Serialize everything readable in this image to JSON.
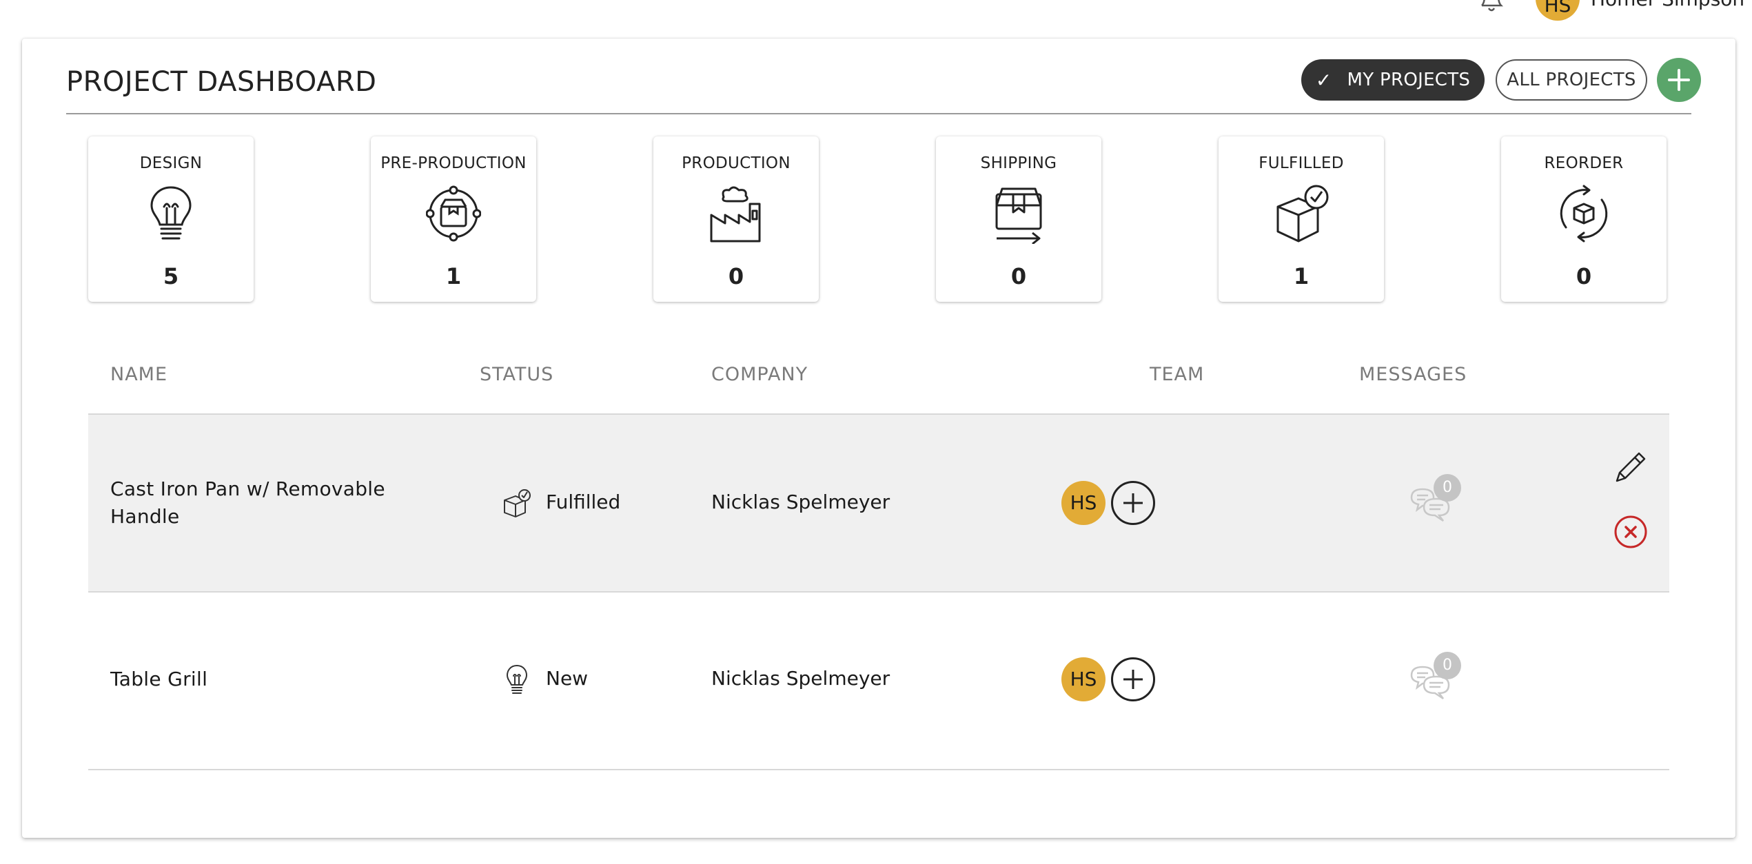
{
  "user": {
    "name": "Homer Simpson",
    "initials": "HS"
  },
  "page": {
    "title": "PROJECT DASHBOARD"
  },
  "filters": {
    "my_projects": "MY PROJECTS",
    "all_projects": "ALL PROJECTS",
    "add_icon": "plus-icon"
  },
  "stages": [
    {
      "label": "DESIGN",
      "count": "5",
      "icon": "lightbulb-icon"
    },
    {
      "label": "PRE-PRODUCTION",
      "count": "1",
      "icon": "box-cycle-icon"
    },
    {
      "label": "PRODUCTION",
      "count": "0",
      "icon": "factory-icon"
    },
    {
      "label": "SHIPPING",
      "count": "0",
      "icon": "shipping-box-icon"
    },
    {
      "label": "FULFILLED",
      "count": "1",
      "icon": "box-check-icon"
    },
    {
      "label": "REORDER",
      "count": "0",
      "icon": "reorder-icon"
    }
  ],
  "table": {
    "headers": {
      "name": "NAME",
      "status": "STATUS",
      "company": "COMPANY",
      "team": "TEAM",
      "messages": "MESSAGES"
    },
    "rows": [
      {
        "name": "Cast Iron Pan w/ Removable Handle",
        "status": "Fulfilled",
        "status_icon": "box-check-icon",
        "company": "Nicklas Spelmeyer",
        "team": [
          "HS"
        ],
        "messages": "0",
        "actions": [
          "pencil-icon",
          "delete-icon"
        ]
      },
      {
        "name": "Table Grill",
        "status": "New",
        "status_icon": "lightbulb-icon",
        "company": "Nicklas Spelmeyer",
        "team": [
          "HS"
        ],
        "messages": "0",
        "actions": []
      }
    ]
  },
  "colors": {
    "accent_green": "#5aa56a",
    "avatar": "#e2ab36",
    "delete_red": "#c62828",
    "pill_dark": "#333333"
  }
}
